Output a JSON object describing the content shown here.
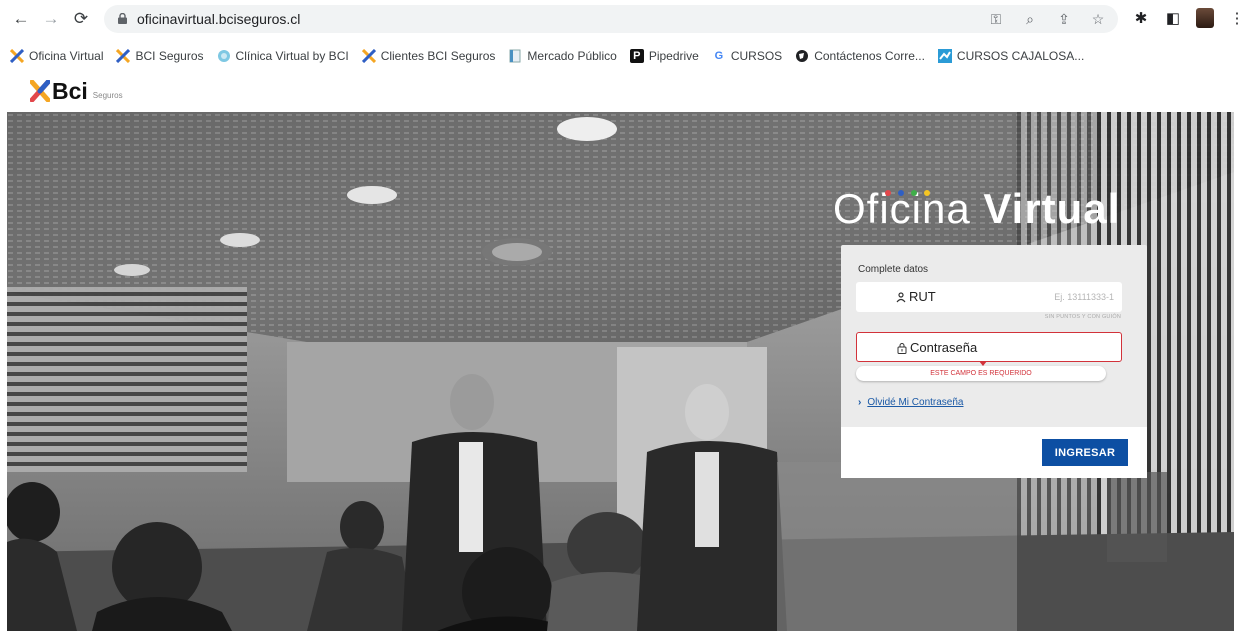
{
  "browser": {
    "url": "oficinavirtual.bciseguros.cl",
    "bookmarks": [
      {
        "label": "Oficina Virtual",
        "icon": "bci-x-icon"
      },
      {
        "label": "BCI Seguros",
        "icon": "bci-x-icon"
      },
      {
        "label": "Clínica Virtual by BCI",
        "icon": "globe-icon"
      },
      {
        "label": "Clientes BCI Seguros",
        "icon": "bci-x-icon"
      },
      {
        "label": "Mercado Público",
        "icon": "document-icon"
      },
      {
        "label": "Pipedrive",
        "icon": "pipedrive-icon"
      },
      {
        "label": "CURSOS",
        "icon": "google-icon"
      },
      {
        "label": "Contáctenos Corre...",
        "icon": "globe-dark-icon"
      },
      {
        "label": "CURSOS CAJALOSA...",
        "icon": "cursos-icon"
      }
    ]
  },
  "site": {
    "logo_text": "Bci",
    "logo_sub": "Seguros"
  },
  "hero": {
    "title_light": "Oficina ",
    "title_bold": "Virtual"
  },
  "login": {
    "section_label": "Complete datos",
    "rut_label": "RUT",
    "rut_placeholder": "Ej. 13111333-1",
    "rut_hint": "SIN PUNTOS Y CON GUIÓN",
    "password_label": "Contraseña",
    "error_message": "ESTE CAMPO ES REQUERIDO",
    "forgot_link": "Olvidé Mi Contraseña",
    "submit_label": "INGRESAR"
  },
  "colors": {
    "brand_blue": "#0d4fa3",
    "error_red": "#d2323a",
    "link_blue": "#1c5aa6"
  }
}
